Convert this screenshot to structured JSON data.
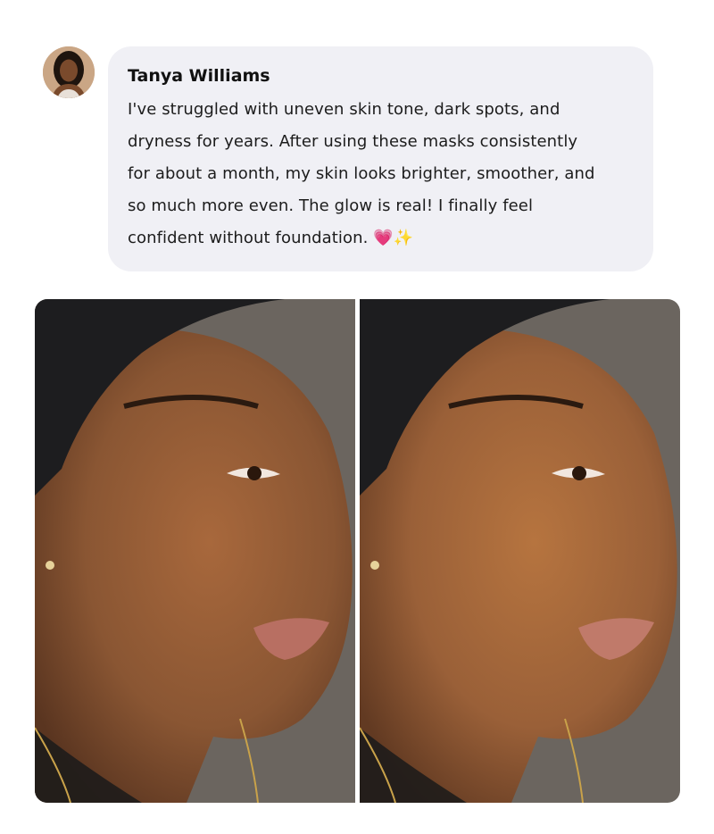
{
  "testimonial": {
    "author_name": "Tanya Williams",
    "avatar_icon": "person-portrait-icon",
    "lines": [
      "I've struggled with uneven skin tone, dark spots, and",
      "dryness for years. After using these masks consistently",
      "for about a month, my skin looks brighter, smoother, and",
      "so much more even. The glow is real! I finally feel",
      "confident without foundation."
    ],
    "emojis": [
      "💗",
      "✨"
    ]
  },
  "images": {
    "before_icon": "face-photo-before-icon",
    "after_icon": "face-photo-after-icon"
  },
  "colors": {
    "bubble_bg": "#f0f0f5",
    "skin_before": "#8a5633",
    "skin_after": "#9a6038",
    "headband": "#1d1d1f",
    "background_wall": "#6b655f"
  }
}
